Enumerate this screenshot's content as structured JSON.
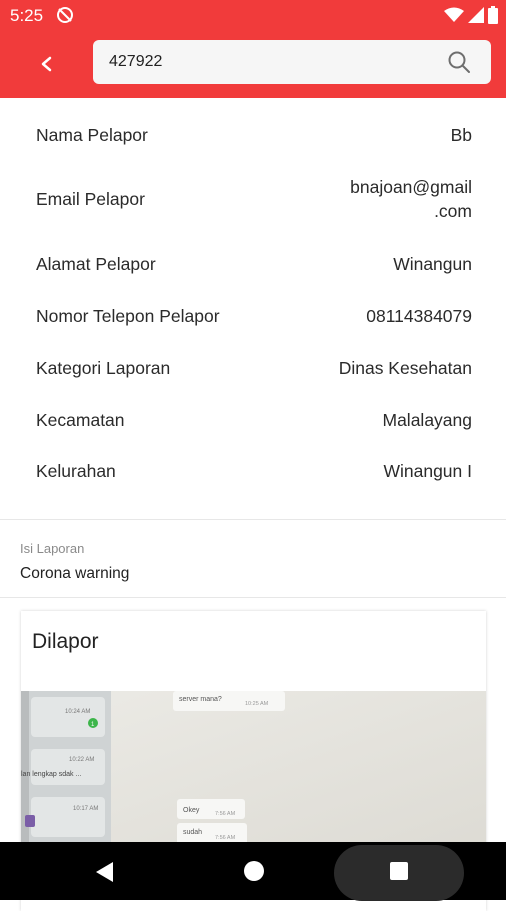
{
  "status_bar": {
    "time": "5:25",
    "icons": [
      "sync-off-icon",
      "wifi-icon",
      "signal-icon",
      "battery-icon"
    ]
  },
  "app_bar": {
    "back_icon": "chevron-left-icon",
    "search": {
      "value": "427922",
      "icon": "search-icon"
    },
    "color": "#f13b3b"
  },
  "details": [
    {
      "label": "Nama Pelapor",
      "value": "Bb"
    },
    {
      "label": "Email Pelapor",
      "value_lines": [
        "bnajoan@gmail",
        ".com"
      ]
    },
    {
      "label": "Alamat Pelapor",
      "value": "Winangun"
    },
    {
      "label": "Nomor Telepon Pelapor",
      "value": "08114384079"
    },
    {
      "label": "Kategori Laporan",
      "value": "Dinas Kesehatan"
    },
    {
      "label": "Kecamatan",
      "value": "Malalayang"
    },
    {
      "label": "Kelurahan",
      "value": "Winangun I"
    }
  ],
  "isi_laporan": {
    "label": "Isi Laporan",
    "value": "Corona warning"
  },
  "card": {
    "title": "Dilapor",
    "photo_chat": {
      "left_bubbles": [
        "10:24 AM",
        "10:22 AM",
        "lan lengkap sdak ...",
        "10:17 AM"
      ],
      "badge": "1",
      "right_bubbles": [
        "server mana?",
        "10:25 AM",
        "Okey",
        "7:56 AM",
        "sudah",
        "7:56 AM"
      ]
    }
  },
  "nav_bar": {
    "icons": [
      "back-triangle-icon",
      "home-circle-icon",
      "recents-square-icon"
    ]
  }
}
